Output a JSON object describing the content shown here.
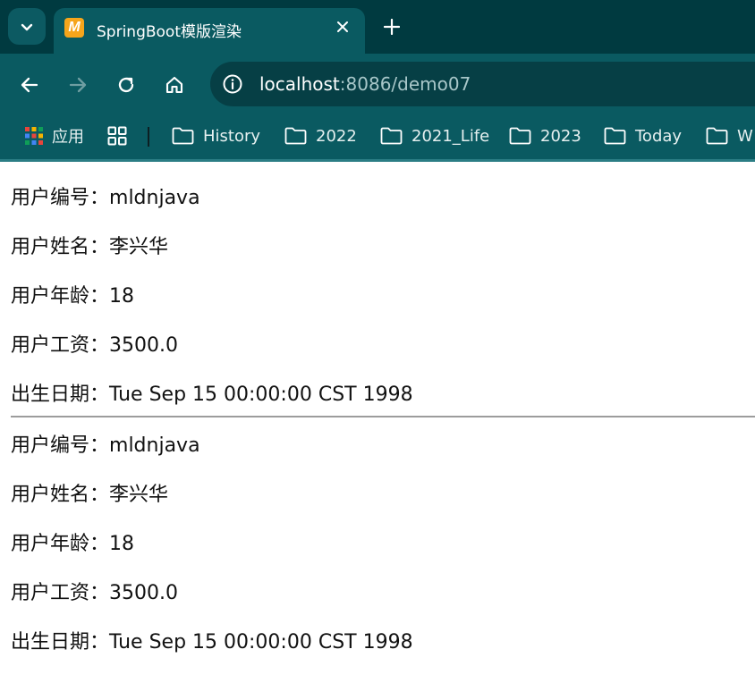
{
  "browser": {
    "tab": {
      "favicon_letter": "M",
      "title": "SpringBoot模版渲染"
    },
    "address": {
      "host": "localhost",
      "rest": ":8086/demo07"
    },
    "bookmarks": [
      {
        "label": "应用",
        "icon": "apps-grid-icon"
      },
      {
        "label": "",
        "icon": "tab-groups-icon"
      },
      {
        "label": "History",
        "icon": "folder-icon"
      },
      {
        "label": "2022",
        "icon": "folder-icon"
      },
      {
        "label": "2021_Life",
        "icon": "folder-icon"
      },
      {
        "label": "2023",
        "icon": "folder-icon"
      },
      {
        "label": "Today",
        "icon": "folder-icon"
      },
      {
        "label": "W",
        "icon": "folder-icon"
      }
    ],
    "colors": {
      "tabstrip": "#003a40",
      "toolbar": "#0a5a61",
      "omnibox": "#063f45"
    }
  },
  "records": [
    {
      "fields": [
        {
          "label": "用户编号：",
          "value": "mldnjava"
        },
        {
          "label": "用户姓名：",
          "value": "李兴华"
        },
        {
          "label": "用户年龄：",
          "value": "18"
        },
        {
          "label": "用户工资：",
          "value": "3500.0"
        },
        {
          "label": "出生日期：",
          "value": "Tue Sep 15 00:00:00 CST 1998"
        }
      ]
    },
    {
      "fields": [
        {
          "label": "用户编号：",
          "value": "mldnjava"
        },
        {
          "label": "用户姓名：",
          "value": "李兴华"
        },
        {
          "label": "用户年龄：",
          "value": "18"
        },
        {
          "label": "用户工资：",
          "value": "3500.0"
        },
        {
          "label": "出生日期：",
          "value": "Tue Sep 15 00:00:00 CST 1998"
        }
      ]
    }
  ]
}
